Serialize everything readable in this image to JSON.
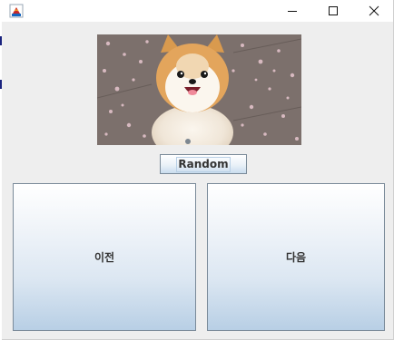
{
  "window": {
    "icon": "java-app-icon",
    "controls": [
      "minimize-icon",
      "maximize-icon",
      "close-icon"
    ]
  },
  "image": {
    "subject_icon": "dog-photo"
  },
  "buttons": {
    "random_label": "Random",
    "prev_label": "이전",
    "next_label": "다음"
  }
}
